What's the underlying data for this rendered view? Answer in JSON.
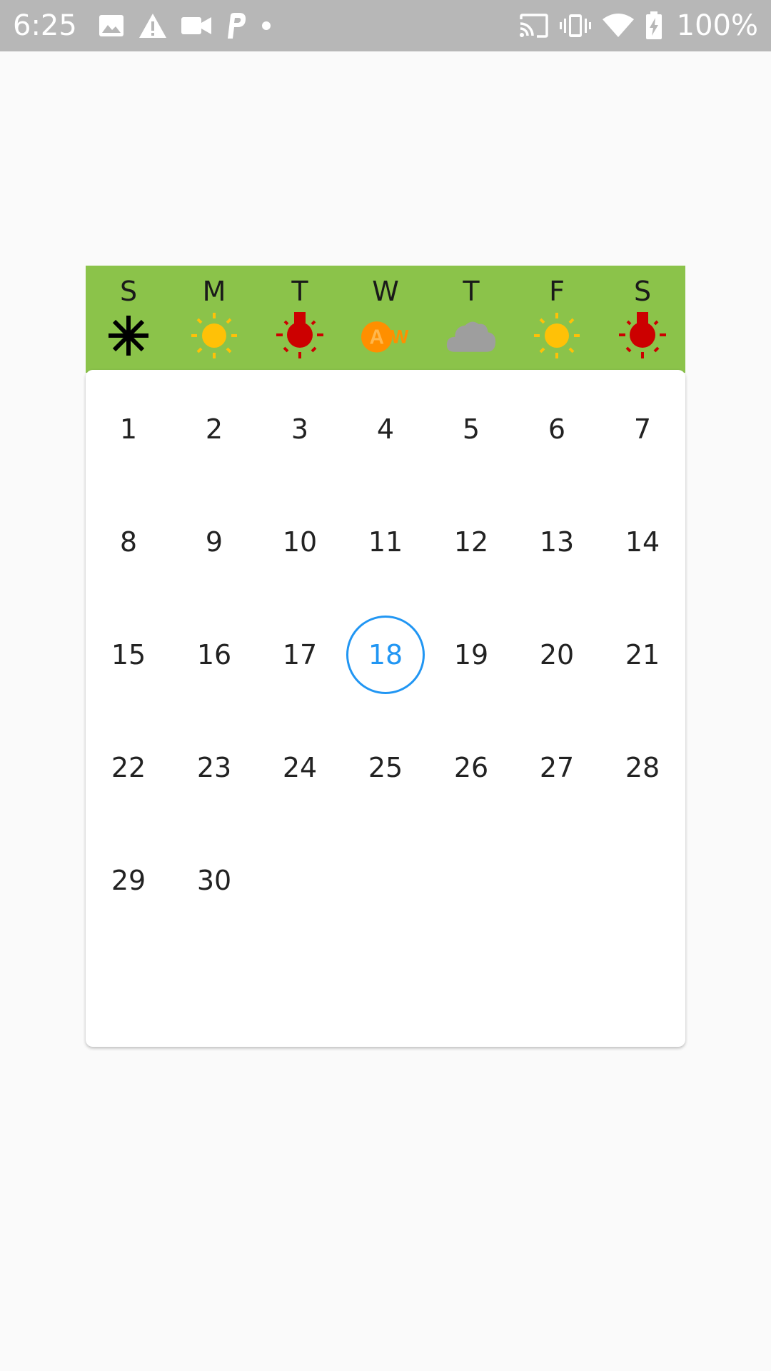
{
  "status_bar": {
    "time": "6:25",
    "battery_percent": "100%",
    "left_icons": [
      "image-icon",
      "warning-icon",
      "video-icon",
      "parking-icon",
      "dot-icon"
    ],
    "right_icons": [
      "cast-icon",
      "vibrate-icon",
      "wifi-icon",
      "battery-charging-icon"
    ]
  },
  "calendar": {
    "header_color": "#8bc34a",
    "today_color": "#2196f3",
    "weekdays": [
      {
        "letter": "S",
        "weather": "snowflake-icon"
      },
      {
        "letter": "M",
        "weather": "sun-icon"
      },
      {
        "letter": "T",
        "weather": "hot-thermometer-icon"
      },
      {
        "letter": "W",
        "weather": "accuweather-logo-icon"
      },
      {
        "letter": "T",
        "weather": "cloud-icon"
      },
      {
        "letter": "F",
        "weather": "sun-icon"
      },
      {
        "letter": "S",
        "weather": "hot-thermometer-icon"
      }
    ],
    "dates": [
      "1",
      "2",
      "3",
      "4",
      "5",
      "6",
      "7",
      "8",
      "9",
      "10",
      "11",
      "12",
      "13",
      "14",
      "15",
      "16",
      "17",
      "18",
      "19",
      "20",
      "21",
      "22",
      "23",
      "24",
      "25",
      "26",
      "27",
      "28",
      "29",
      "30"
    ],
    "today": "18",
    "weather_logo_text": "AW"
  }
}
